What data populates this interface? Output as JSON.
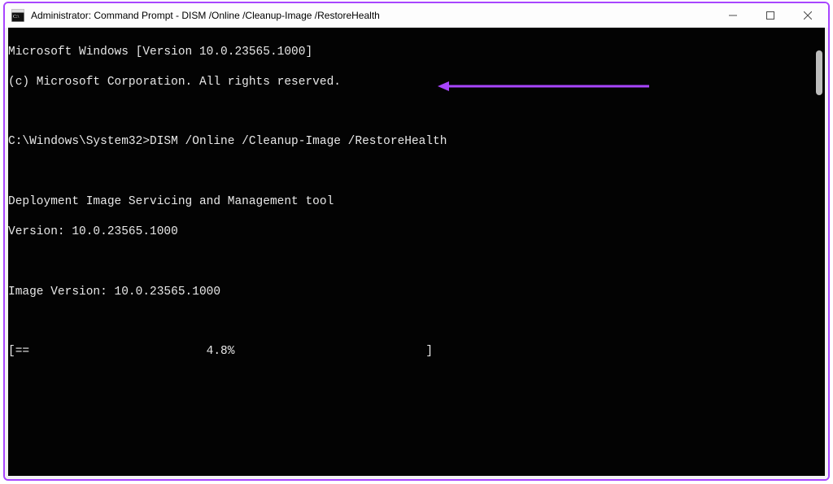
{
  "window": {
    "title": "Administrator: Command Prompt - DISM  /Online /Cleanup-Image /RestoreHealth",
    "icon_name": "cmd-icon"
  },
  "terminal": {
    "line1": "Microsoft Windows [Version 10.0.23565.1000]",
    "line2": "(c) Microsoft Corporation. All rights reserved.",
    "blank1": "",
    "prompt_line": "C:\\Windows\\System32>DISM /Online /Cleanup-Image /RestoreHealth",
    "blank2": "",
    "tool_line1": "Deployment Image Servicing and Management tool",
    "tool_line2": "Version: 10.0.23565.1000",
    "blank3": "",
    "image_version": "Image Version: 10.0.23565.1000",
    "blank4": "",
    "progress_line": "[==                         4.8%                           ]"
  },
  "accent_color": "#a845ff"
}
